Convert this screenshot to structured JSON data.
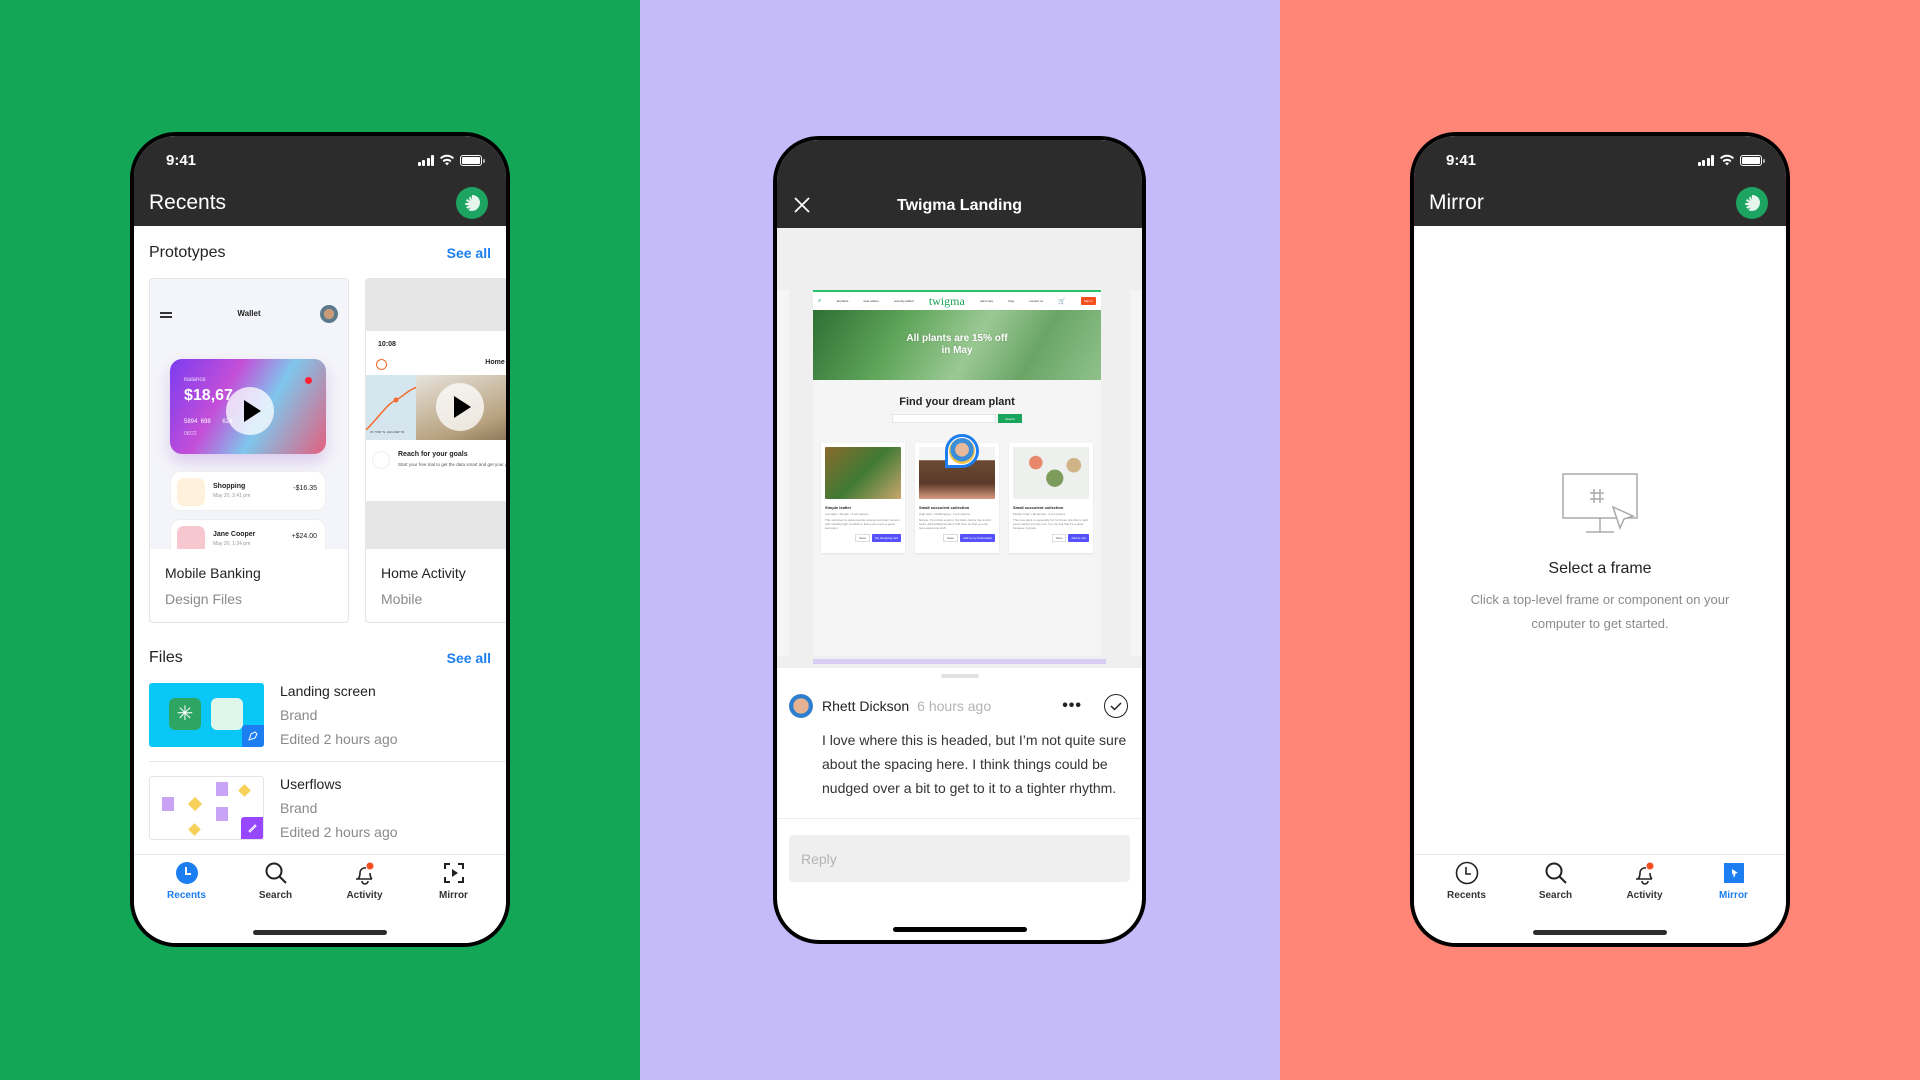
{
  "colors": {
    "panel_left": "#12a656",
    "panel_middle": "#c5bbfa",
    "panel_right": "#ff8576",
    "accent_blue": "#1c7ef0",
    "notification_dot": "#f24e1e",
    "topbar": "#2c2c2c"
  },
  "phone_recents": {
    "status_time": "9:41",
    "title": "Recents",
    "avatar_icon": "monstera-leaf-icon",
    "prototypes": {
      "heading": "Prototypes",
      "see_all": "See all",
      "items": [
        {
          "name": "Mobile Banking",
          "subtitle": "Design Files",
          "thumb": {
            "header": "Wallet",
            "card_label": "Balance",
            "card_amount": "$18,67",
            "card_number": "5894  698       624",
            "card_expiry": "08/22",
            "transactions": [
              {
                "name": "Shopping",
                "date": "May 20, 3:41 pm",
                "amount": "-$16.35"
              },
              {
                "name": "Jane Cooper",
                "date": "May 20, 1:24 pm",
                "amount": "+$24.00"
              }
            ]
          }
        },
        {
          "name": "Home Activity",
          "subtitle": "Mobile",
          "thumb": {
            "time": "10:08",
            "header": "Home",
            "coords": "37.7749° N, 122.4194° W",
            "cta_title": "Reach for your goals",
            "cta_text": "Start your free trial to get the data smart and get your goals."
          }
        }
      ]
    },
    "files": {
      "heading": "Files",
      "see_all": "See all",
      "items": [
        {
          "name": "Landing screen",
          "team": "Brand",
          "edited": "Edited 2 hours ago",
          "type": "design"
        },
        {
          "name": "Userflows",
          "team": "Brand",
          "edited": "Edited 2 hours ago",
          "type": "figjam"
        }
      ]
    },
    "tabs": [
      {
        "label": "Recents",
        "icon": "clock-icon",
        "active": true
      },
      {
        "label": "Search",
        "icon": "search-icon",
        "active": false
      },
      {
        "label": "Activity",
        "icon": "bell-icon",
        "active": false,
        "badge": true
      },
      {
        "label": "Mirror",
        "icon": "mirror-icon",
        "active": false
      }
    ]
  },
  "phone_prototype": {
    "title": "Twigma Landing",
    "close_icon": "close-icon",
    "site": {
      "brand": "twigma",
      "nav_left": [
        "all plants",
        "best sellers",
        "recently added"
      ],
      "nav_right": [
        "plant care",
        "blog",
        "contact us"
      ],
      "signin": "Sign in",
      "hero_text": "All plants are 15% off in May",
      "find_title": "Find your dream plant",
      "search_button": "Search",
      "products": [
        {
          "title": "Simple leaflet",
          "meta": "Low light • Simple • 3 pot options",
          "desc": "This succulent is quite popular among new plant owners with variable light conditions. Everyone loves a great succulent.",
          "save": "Save",
          "primary": "My shopping cart"
        },
        {
          "title": "Small succulent collection",
          "meta": "High light • Challenging • 3 pot options",
          "desc": "Simple. It's prickly exterior, the baby cactus has a kind heart. Add additional plant stuff here so that you can have awesome stuff.",
          "save": "Save",
          "primary": "Add to my bookmarks"
        },
        {
          "title": "Small succulent collection",
          "meta": "Medium light • Moderate • 2 pot options",
          "desc": "This new plant is especially fun for those who like to add some variety into the mix. You can tell that it's a plant because it grows.",
          "save": "Save",
          "primary": "Add to cart"
        }
      ]
    },
    "comment": {
      "author": "Rhett Dickson",
      "time": "6 hours ago",
      "body": "I love where this is headed, but I’m not quite sure about the spacing here. I think things could be nudged over a bit to get to it to a tighter rhythm.",
      "more_label": "•••"
    },
    "reply_placeholder": "Reply"
  },
  "phone_mirror": {
    "status_time": "9:41",
    "title": "Mirror",
    "avatar_icon": "monstera-leaf-icon",
    "empty_icon": "monitor-cursor-icon",
    "empty_title": "Select a frame",
    "empty_desc": "Click a top-level frame or component on your computer to get started.",
    "tabs": [
      {
        "label": "Recents",
        "icon": "clock-icon",
        "active": false
      },
      {
        "label": "Search",
        "icon": "search-icon",
        "active": false
      },
      {
        "label": "Activity",
        "icon": "bell-icon",
        "active": false,
        "badge": true
      },
      {
        "label": "Mirror",
        "icon": "mirror-icon",
        "active": true
      }
    ]
  }
}
